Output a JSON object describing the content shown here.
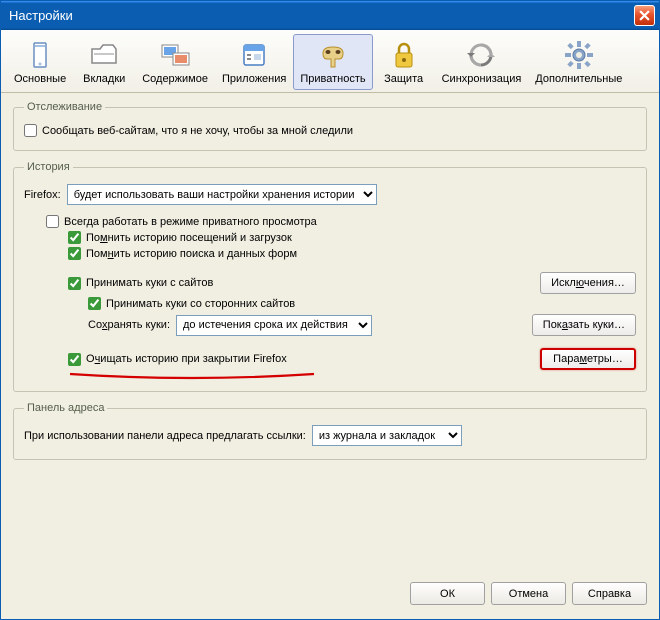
{
  "window": {
    "title": "Настройки"
  },
  "toolbar": {
    "items": [
      {
        "label": "Основные"
      },
      {
        "label": "Вкладки"
      },
      {
        "label": "Содержимое"
      },
      {
        "label": "Приложения"
      },
      {
        "label": "Приватность"
      },
      {
        "label": "Защита"
      },
      {
        "label": "Синхронизация"
      },
      {
        "label": "Дополнительные"
      }
    ],
    "active_index": 4
  },
  "tracking": {
    "legend": "Отслеживание",
    "dnt_label": "Сообщать веб-сайтам, что я не хочу, чтобы за мной следили"
  },
  "history": {
    "legend": "История",
    "firefox_label": "Firefox:",
    "mode_select": "будет использовать ваши настройки хранения истории",
    "always_private": "Всегда работать в режиме приватного просмотра",
    "remember_history": "Помнить историю посещений и загрузок",
    "remember_forms": "Помнить историю поиска и данных форм",
    "accept_cookies": "Принимать куки с сайтов",
    "exceptions_btn": "Исключения…",
    "accept_third": "Принимать куки со сторонних сайтов",
    "keep_cookies_label": "Сохранять куки:",
    "keep_cookies_select": "до истечения срока их действия",
    "show_cookies_btn": "Показать куки…",
    "clear_on_close": "Очищать историю при закрытии Firefox",
    "settings_btn": "Параметры…"
  },
  "locationbar": {
    "legend": "Панель адреса",
    "suggest_label": "При использовании панели адреса предлагать ссылки:",
    "suggest_select": "из журнала и закладок"
  },
  "buttons": {
    "ok": "ОК",
    "cancel": "Отмена",
    "help": "Справка"
  }
}
